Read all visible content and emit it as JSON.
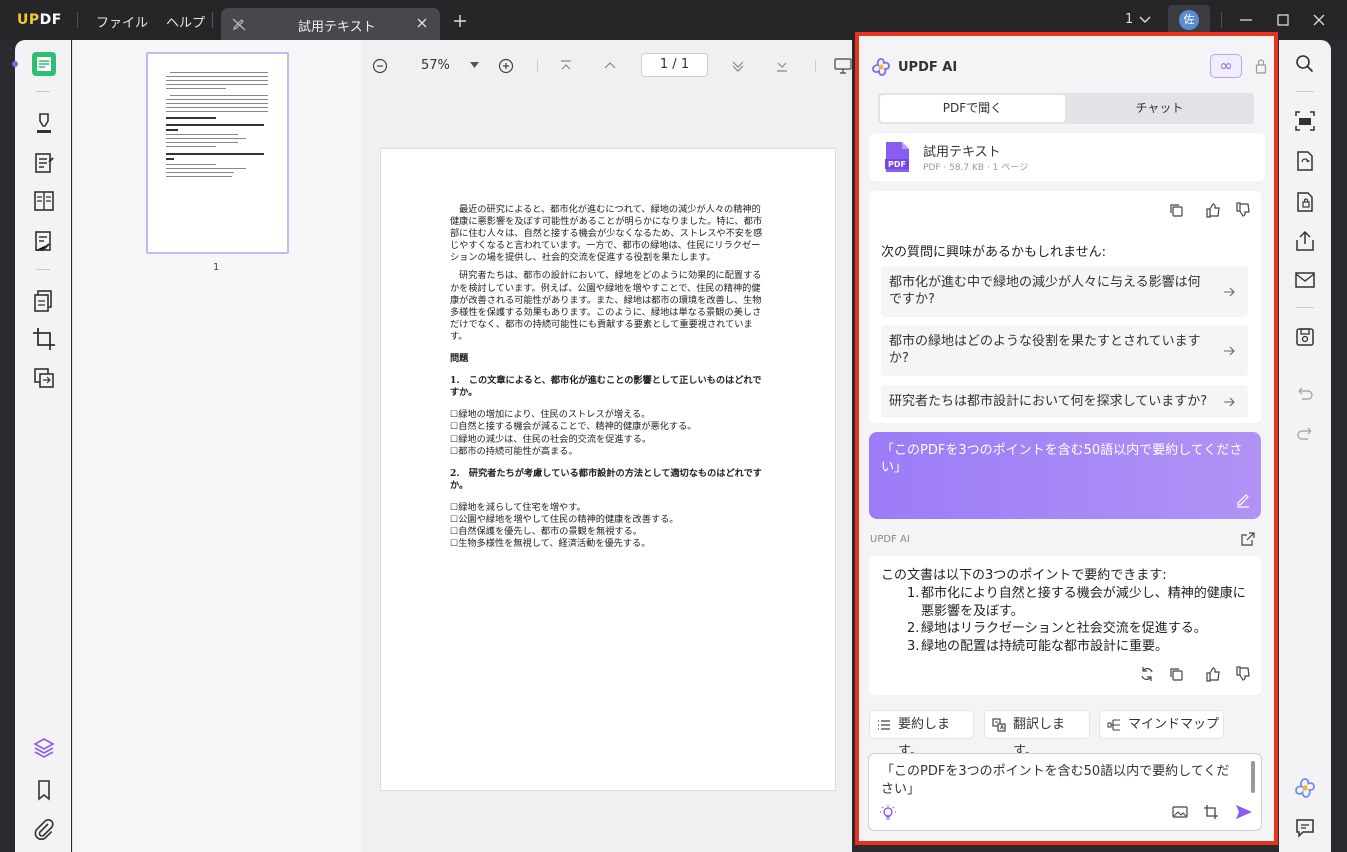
{
  "app": {
    "logo_a": "UP",
    "logo_b": "DF",
    "menu": [
      "ファイル",
      "ヘルプ"
    ],
    "tab_title": "試用テキスト",
    "page_count": "1"
  },
  "avatar": {
    "initial": "佐"
  },
  "toolbar": {
    "zoom": "57%",
    "page_current": "1",
    "page_total": "1",
    "page_sep": "/"
  },
  "thumbnail": {
    "page_number": "1"
  },
  "document": {
    "paragraphs": [
      "最近の研究によると、都市化が進むにつれて、緑地の減少が人々の精神的健康に悪影響を及ぼす可能性があることが明らかになりました。特に、都市部に住む人々は、自然と接する機会が少なくなるため、ストレスや不安を感じやすくなると言われています。一方で、都市の緑地は、住民にリラクゼーションの場を提供し、社会的交流を促進する役割を果たします。",
      "研究者たちは、都市の設計において、緑地をどのように効果的に配置するかを検討しています。例えば、公園や緑地を増やすことで、住民の精神的健康が改善される可能性があります。また、緑地は都市の環境を改善し、生物多様性を保護する効果もあります。このように、緑地は単なる景観の美しさだけでなく、都市の持続可能性にも貢献する要素として重要視されています。"
    ],
    "section_title": "問題",
    "q1": "1.　この文章によると、都市化が進むことの影響として正しいものはどれですか。",
    "q1_options": [
      "☐緑地の増加により、住民のストレスが増える。",
      "☐自然と接する機会が減ることで、精神的健康が悪化する。",
      "☐緑地の減少は、住民の社会的交流を促進する。",
      "☐都市の持続可能性が高まる。"
    ],
    "q2": "2.　研究者たちが考慮している都市設計の方法として適切なものはどれですか。",
    "q2_options": [
      "☐緑地を減らして住宅を増やす。",
      "☐公園や緑地を増やして住民の精神的健康を改善する。",
      "☐自然保護を優先し、都市の景観を無視する。",
      "☐生物多様性を無視して、経済活動を優先する。"
    ]
  },
  "ai": {
    "title": "UPDF AI",
    "plan_badge": "∞",
    "tabs": {
      "open": "PDFで聞く",
      "chat": "チャット"
    },
    "file": {
      "name": "試用テキスト",
      "meta": "PDF · 58.7 KB · 1 ページ",
      "icon_label": "PDF"
    },
    "suggest_title": "次の質問に興味があるかもしれません:",
    "suggestions": [
      "都市化が進む中で緑地の減少が人々に与える影響は何ですか?",
      "都市の緑地はどのような役割を果たすとされていますか?",
      "研究者たちは都市設計において何を探求していますか?"
    ],
    "user_message": "「このPDFを3つのポイントを含む50語以内で要約してください」",
    "responder": "UPDF AI",
    "answer_intro": "この文書は以下の3つのポイントで要約できます:",
    "answer_items": [
      {
        "num": "1.",
        "text": "都市化により自然と接する機会が減少し、精神的健康に悪影響を及ぼす。"
      },
      {
        "num": "2.",
        "text": "緑地はリラクゼーションと社会交流を促進する。"
      },
      {
        "num": "3.",
        "text": "緑地の配置は持続可能な都市設計に重要。"
      }
    ],
    "chips": {
      "summarize": "要約します。",
      "translate": "翻訳します。",
      "mindmap": "マインドマップ"
    },
    "input_value": "「このPDFを3つのポイントを含む50語以内で要約してください」"
  },
  "colors": {
    "accent": "#8a5cf0",
    "highlight_border": "#e8341e",
    "bubble": "#a486f7"
  }
}
